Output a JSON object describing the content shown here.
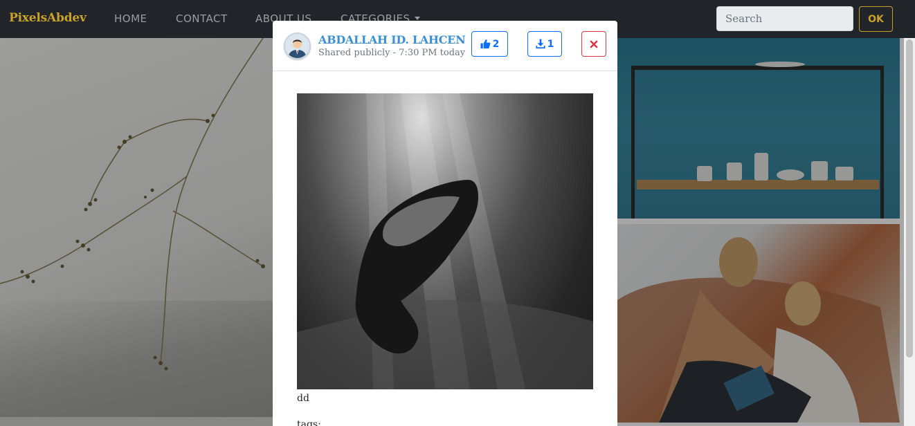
{
  "navbar": {
    "brand": "PixelsAbdev",
    "links": [
      {
        "label": "HOME"
      },
      {
        "label": "CONTACT"
      },
      {
        "label": "ABOUT US"
      },
      {
        "label": "CATEGORIES"
      }
    ],
    "search_placeholder": "Search",
    "search_value": "",
    "submit_label": "OK"
  },
  "modal": {
    "author": "ABDALLAH ID. LAHCEN",
    "meta": "Shared publicly - 7:30 PM today",
    "likes": "2",
    "downloads": "1",
    "caption": "dd",
    "tags_label": "tags:"
  },
  "colors": {
    "brand": "#c9a227",
    "navbar_bg": "#212529",
    "author": "#3b8fd3",
    "primary": "#0d6efd",
    "danger": "#dc3545"
  },
  "icons": {
    "like": "thumbs-up-icon",
    "download": "download-icon",
    "close": "close-icon",
    "dropdown": "caret-down-icon"
  }
}
